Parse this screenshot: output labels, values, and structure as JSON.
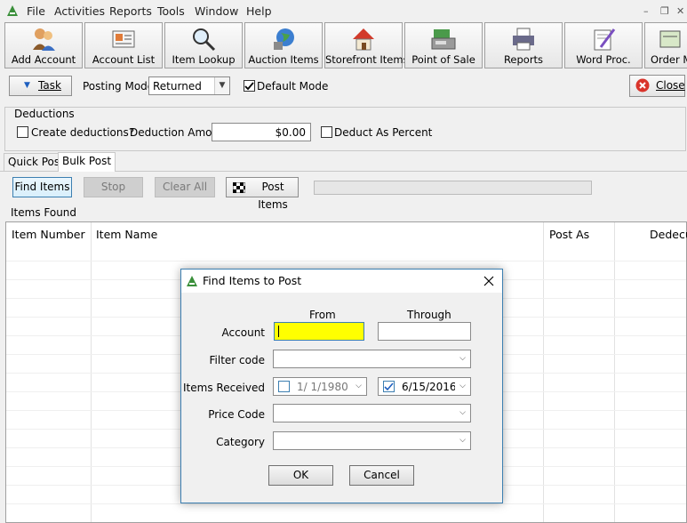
{
  "menu": {
    "items": [
      "File",
      "Activities",
      "Reports",
      "Tools",
      "Window",
      "Help"
    ],
    "window_controls": [
      "–",
      "❐",
      "✕"
    ]
  },
  "toolbar": {
    "buttons": [
      {
        "label": "Add Account",
        "icon": "add-account-icon"
      },
      {
        "label": "Account List",
        "icon": "account-list-icon"
      },
      {
        "label": "Item Lookup",
        "icon": "magnifier-icon"
      },
      {
        "label": "Auction Items",
        "icon": "globe-icon"
      },
      {
        "label": "Storefront Items",
        "icon": "house-icon"
      },
      {
        "label": "Point of Sale",
        "icon": "cash-register-icon"
      },
      {
        "label": "Reports",
        "icon": "printer-icon"
      },
      {
        "label": "Word Proc.",
        "icon": "word-processor-icon"
      },
      {
        "label": "Order Ma",
        "icon": "order-icon"
      }
    ]
  },
  "task_row": {
    "task_label": "Task",
    "posting_mode_label": "Posting Mode",
    "posting_mode_value": "Returned",
    "default_mode_label": "Default Mode",
    "default_mode_checked": true,
    "close_label": "Close"
  },
  "deductions": {
    "group_label": "Deductions",
    "create_label": "Create deductions?",
    "amount_label": "Deduction Amount",
    "amount_value": "$0.00",
    "percent_label": "Deduct As Percent"
  },
  "tabs": [
    "Quick Post",
    "Bulk Post"
  ],
  "actions": {
    "find_items": "Find Items",
    "stop": "Stop",
    "clear_all": "Clear All",
    "post_items": "Post Items"
  },
  "items_found_label": "Items Found",
  "grid": {
    "columns": [
      "Item Number",
      "Item Name",
      "Post As",
      "Dedecution"
    ]
  },
  "dialog": {
    "title": "Find Items to Post",
    "from_label": "From",
    "through_label": "Through",
    "account_label": "Account",
    "filter_code_label": "Filter code",
    "items_received_label": "Items Received",
    "received_from": "1/  1/1980",
    "received_through": "6/15/2016",
    "price_code_label": "Price Code",
    "category_label": "Category",
    "ok_label": "OK",
    "cancel_label": "Cancel"
  }
}
